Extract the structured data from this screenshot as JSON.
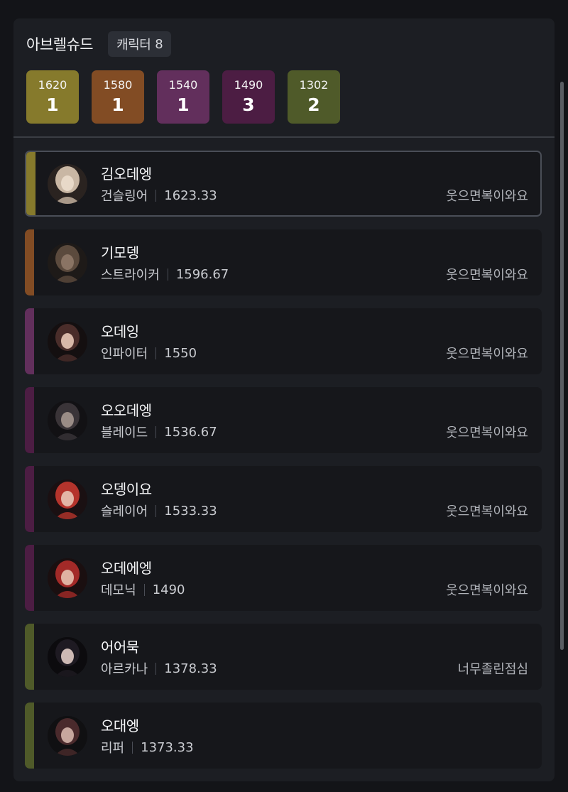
{
  "header": {
    "server_name": "아브렐슈드",
    "count_label": "캐릭터",
    "count_value": "8"
  },
  "tiers": [
    {
      "level": "1620",
      "count": "1",
      "color": "#867a2c"
    },
    {
      "level": "1580",
      "count": "1",
      "color": "#824c24"
    },
    {
      "level": "1540",
      "count": "1",
      "color": "#622f5c"
    },
    {
      "level": "1490",
      "count": "3",
      "color": "#4c1d43"
    },
    {
      "level": "1302",
      "count": "2",
      "color": "#4f5a29"
    }
  ],
  "characters": [
    {
      "name": "김오데엥",
      "class": "건슬링어",
      "item_level": "1623.33",
      "guild": "웃으면복이와요",
      "accent": "#867a2c",
      "selected": true,
      "avatar": "gunslinger-portrait-icon"
    },
    {
      "name": "기모뎅",
      "class": "스트라이커",
      "item_level": "1596.67",
      "guild": "웃으면복이와요",
      "accent": "#824c24",
      "selected": false,
      "avatar": "striker-portrait-icon"
    },
    {
      "name": "오데잉",
      "class": "인파이터",
      "item_level": "1550",
      "guild": "웃으면복이와요",
      "accent": "#622f5c",
      "selected": false,
      "avatar": "infighter-portrait-icon"
    },
    {
      "name": "오오데엥",
      "class": "블레이드",
      "item_level": "1536.67",
      "guild": "웃으면복이와요",
      "accent": "#4c1d43",
      "selected": false,
      "avatar": "blade-portrait-icon"
    },
    {
      "name": "오뎅이요",
      "class": "슬레이어",
      "item_level": "1533.33",
      "guild": "웃으면복이와요",
      "accent": "#4c1d43",
      "selected": false,
      "avatar": "slayer-portrait-icon"
    },
    {
      "name": "오데에엥",
      "class": "데모닉",
      "item_level": "1490",
      "guild": "웃으면복이와요",
      "accent": "#4c1d43",
      "selected": false,
      "avatar": "demonic-portrait-icon"
    },
    {
      "name": "어어묵",
      "class": "아르카나",
      "item_level": "1378.33",
      "guild": "너무졸린점심",
      "accent": "#4f5a29",
      "selected": false,
      "avatar": "arcana-portrait-icon"
    },
    {
      "name": "오대엥",
      "class": "리퍼",
      "item_level": "1373.33",
      "guild": "",
      "accent": "#4f5a29",
      "selected": false,
      "avatar": "reaper-portrait-icon"
    }
  ]
}
